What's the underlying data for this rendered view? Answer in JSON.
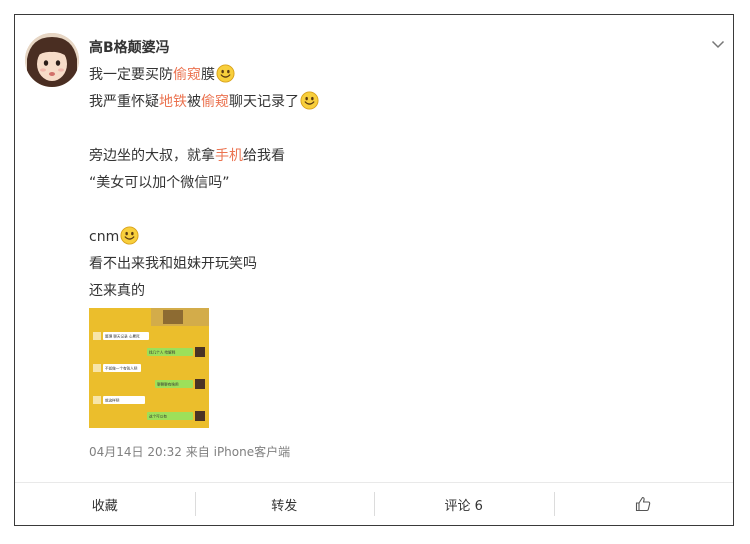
{
  "post": {
    "username": "高B格颠婆冯",
    "lines": [
      {
        "segments": [
          {
            "text": "我一定要买防"
          },
          {
            "text": "偷窥",
            "hl": true
          },
          {
            "text": "膜"
          }
        ],
        "emoji": "smile-emoji"
      },
      {
        "segments": [
          {
            "text": "我严重怀疑"
          },
          {
            "text": "地铁",
            "hl": true
          },
          {
            "text": "被"
          },
          {
            "text": "偷窥",
            "hl": true
          },
          {
            "text": "聊天记录了"
          }
        ],
        "emoji": "smile-emoji"
      },
      {
        "gap": true
      },
      {
        "segments": [
          {
            "text": "旁边坐的大叔，就拿"
          },
          {
            "text": "手机",
            "hl": true
          },
          {
            "text": "给我看"
          }
        ]
      },
      {
        "segments": [
          {
            "text": "“美女可以加个微信吗”"
          }
        ]
      },
      {
        "gap": true
      },
      {
        "segments": [
          {
            "text": "cnm"
          }
        ],
        "emoji": "smile-emoji"
      },
      {
        "segments": [
          {
            "text": "看不出来我和姐妹开玩笑吗"
          }
        ]
      },
      {
        "segments": [
          {
            "text": "还来真的"
          }
        ]
      }
    ],
    "thumbnail": {
      "chat_messages": [
        {
          "side": "left",
          "text": "整理 聊天记录 心累死"
        },
        {
          "side": "right",
          "text": "找几个人 给解释"
        },
        {
          "side": "left",
          "text": "不如做一个有钱人吧"
        },
        {
          "side": "right",
          "text": "聊聊聊有啥用"
        },
        {
          "side": "left",
          "text": "就这样吧"
        },
        {
          "side": "right",
          "text": "这个可以有"
        }
      ]
    },
    "meta": {
      "time": "04月14日 20:32",
      "source_prefix": "来自",
      "source": "iPhone客户端"
    }
  },
  "toolbar": {
    "favorite": "收藏",
    "repost": "转发",
    "comment": "评论 6"
  },
  "colors": {
    "highlight": "#eb7350",
    "emoji_face": "#f8cf3c",
    "thumb_bg": "#e8b922",
    "chat_green": "#9de05a"
  }
}
